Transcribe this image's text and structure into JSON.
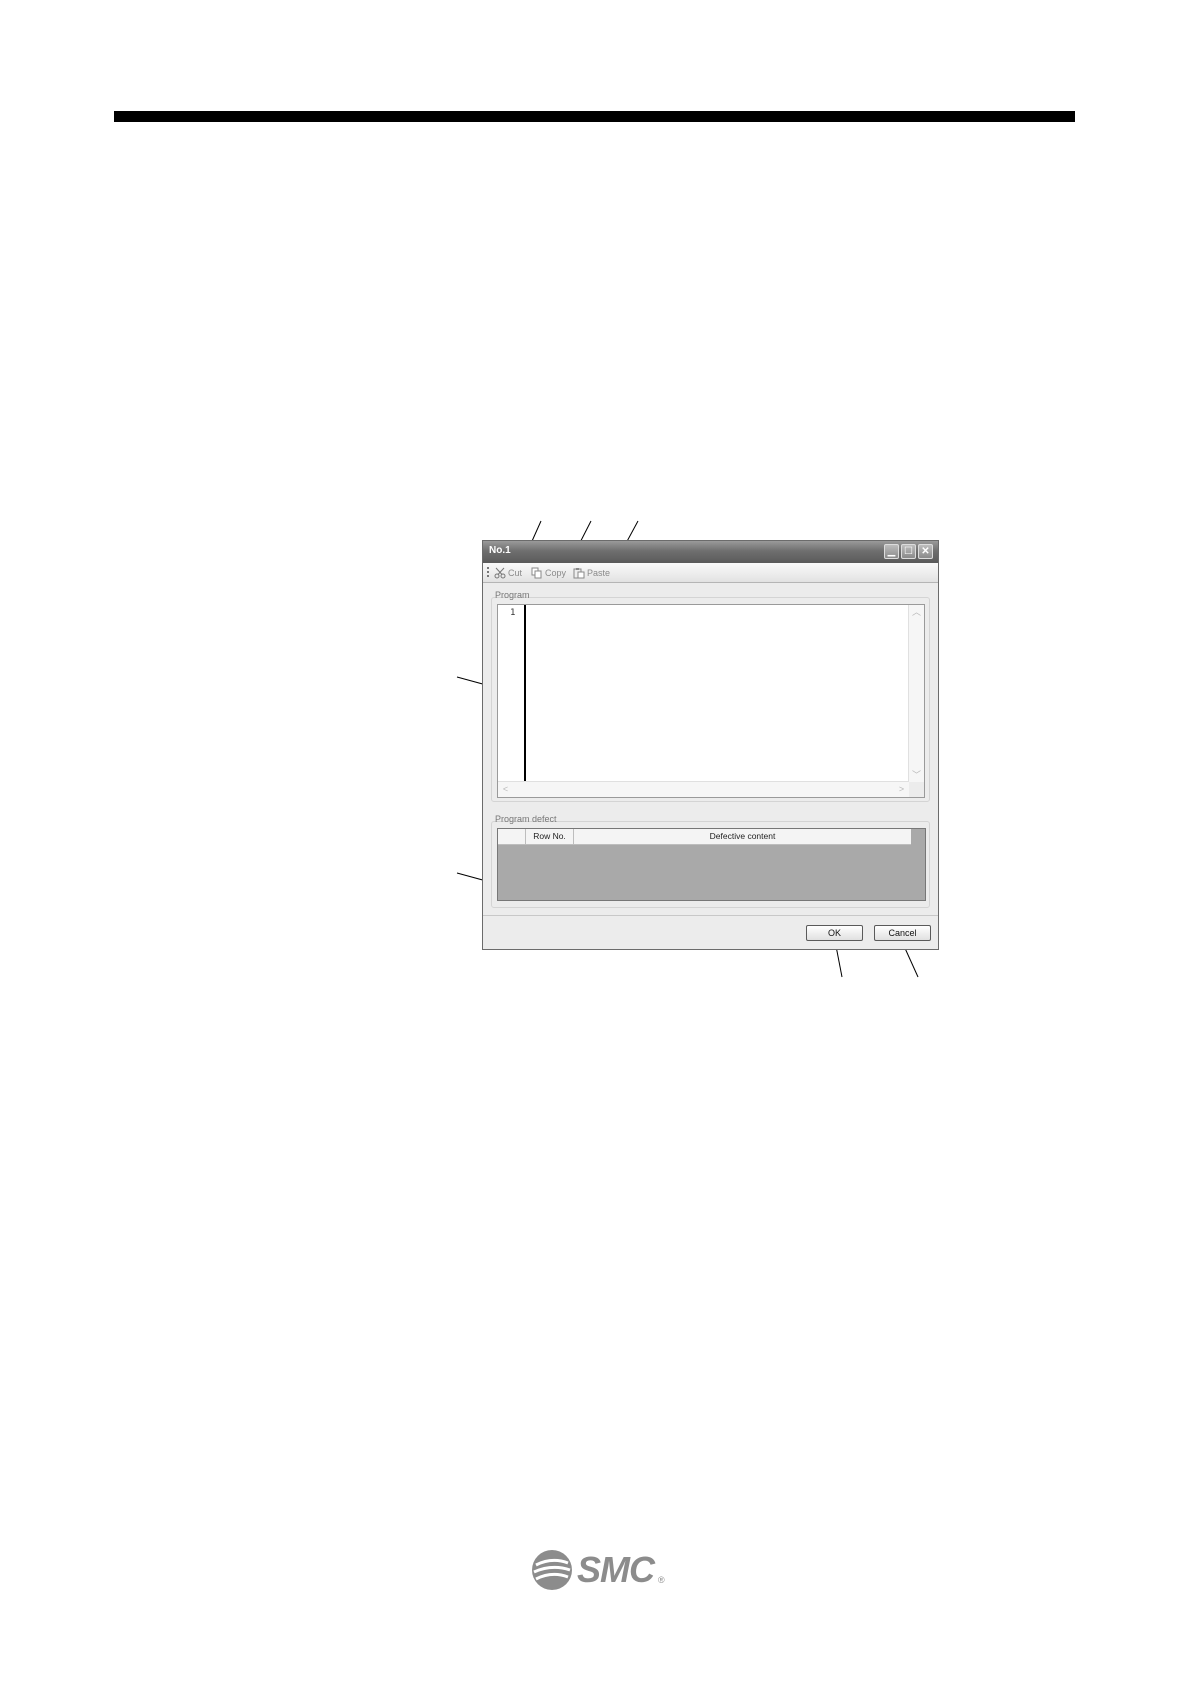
{
  "window": {
    "title": "No.1",
    "controls": {
      "minimize": "▁",
      "maximize": "☐",
      "close": "✕"
    }
  },
  "toolbar": {
    "cut_label": "Cut",
    "copy_label": "Copy",
    "paste_label": "Paste"
  },
  "program": {
    "label": "Program",
    "line_numbers": [
      "1"
    ]
  },
  "defect": {
    "label": "Program defect",
    "columns": [
      "",
      "Row No.",
      "Defective content"
    ]
  },
  "buttons": {
    "ok_label": "OK",
    "cancel_label": "Cancel"
  },
  "footer": {
    "logo_text": "SMC",
    "logo_mark": "®"
  },
  "icons": [
    "scissors-icon",
    "copy-icon",
    "paste-icon",
    "minimize-icon",
    "maximize-icon",
    "close-icon",
    "smc-logo-icon"
  ]
}
